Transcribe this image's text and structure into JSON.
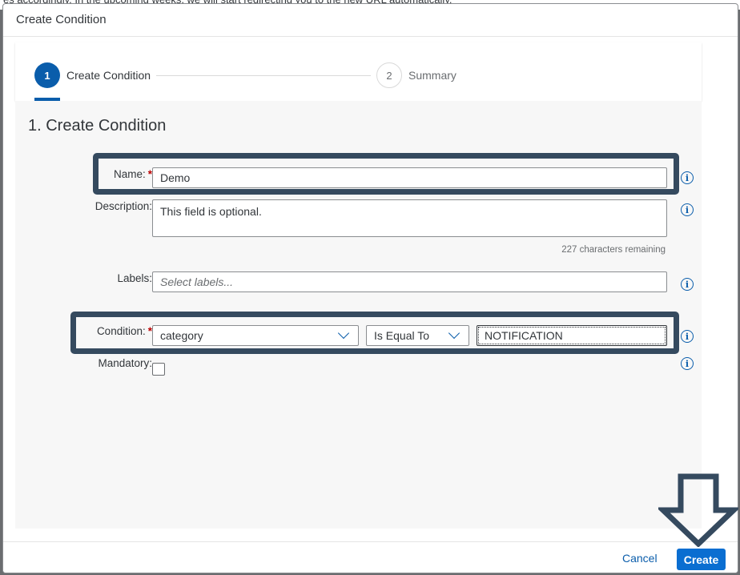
{
  "background": {
    "text": "es accordingly. In the upcoming weeks, we will start redirecting you to the new URL automatically."
  },
  "dialog": {
    "title": "Create Condition"
  },
  "wizard": {
    "steps": [
      {
        "number": "1",
        "label": "Create Condition",
        "state": "active"
      },
      {
        "number": "2",
        "label": "Summary",
        "state": "inactive"
      }
    ]
  },
  "section": {
    "title": "1. Create Condition"
  },
  "form": {
    "name": {
      "label": "Name:",
      "required": "*",
      "value": "Demo"
    },
    "description": {
      "label": "Description:",
      "value": "This field is optional.",
      "remaining": "227 characters remaining"
    },
    "labels": {
      "label": "Labels:",
      "placeholder": "Select labels..."
    },
    "condition": {
      "label": "Condition:",
      "required": "*",
      "field": "category",
      "operator": "Is Equal To",
      "value": "NOTIFICATION"
    },
    "mandatory": {
      "label": "Mandatory:",
      "checked": false
    }
  },
  "icons": {
    "info": "i"
  },
  "footer": {
    "cancel_label": "Cancel",
    "create_label": "Create"
  },
  "colors": {
    "accent": "#0a6ed1",
    "highlight": "#354a5f",
    "required": "#bb0000"
  }
}
